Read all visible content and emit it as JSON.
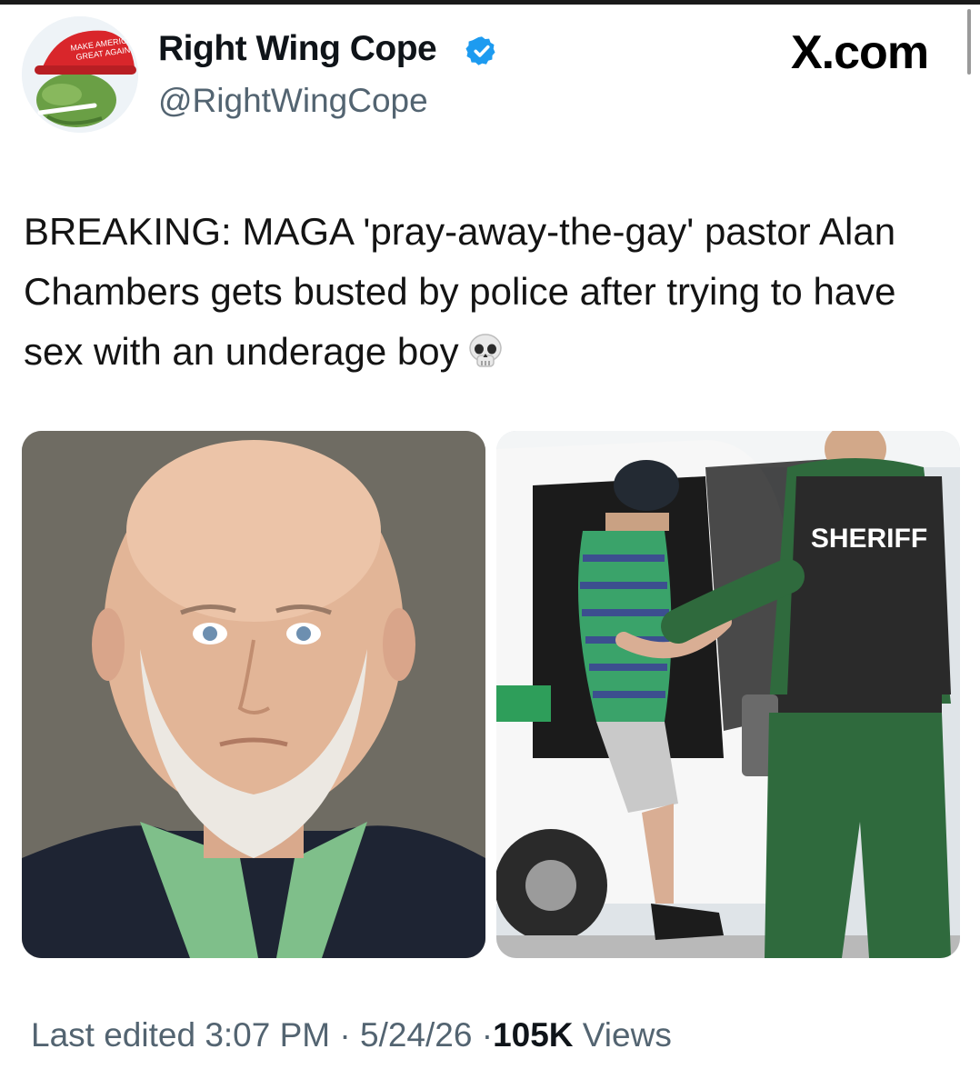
{
  "author": {
    "display_name": "Right Wing Cope",
    "handle": "@RightWingCope",
    "verified_icon": "verified-badge-icon",
    "avatar_icon": "frog-maga-hat-avatar"
  },
  "platform": {
    "brand": "X.com"
  },
  "post": {
    "text": "BREAKING: MAGA 'pray-away-the-gay' pastor Alan Chambers gets busted by police after trying to have sex with an underage boy",
    "emoji": "💀"
  },
  "media": [
    {
      "alt_icon": "mugshot-photo"
    },
    {
      "alt_icon": "arrest-photo",
      "vest_label": "SHERIFF"
    }
  ],
  "footer": {
    "edited_label": "Last edited",
    "time": "3:07 PM",
    "date": "5/24/26",
    "views_count": "105K",
    "views_label": "Views"
  },
  "colors": {
    "verified": "#1d9bf0",
    "secondary_text": "#536471",
    "hat": "#d9262b",
    "frog": "#6a9f45"
  }
}
